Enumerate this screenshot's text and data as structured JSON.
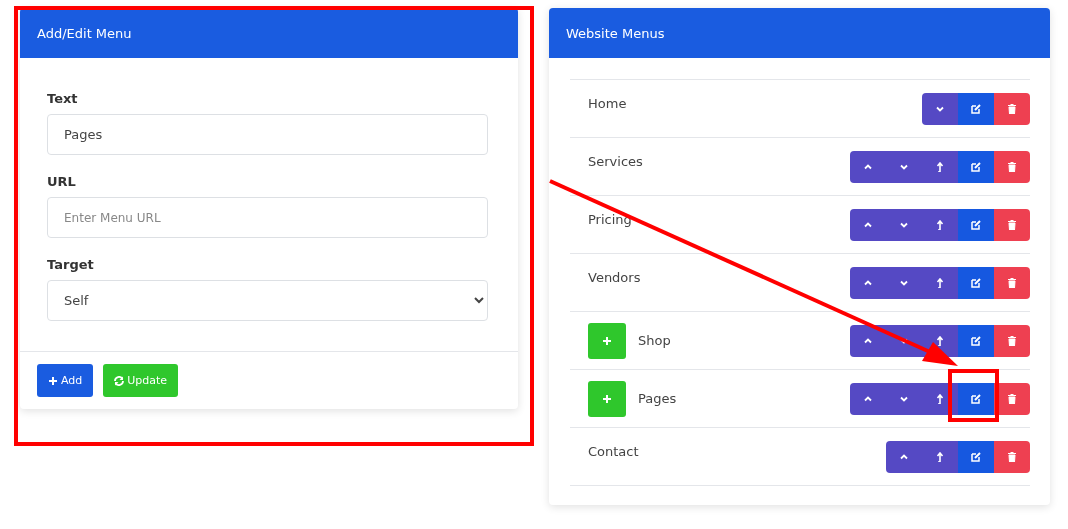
{
  "form_panel": {
    "title": "Add/Edit Menu",
    "fields": [
      {
        "kind": "text",
        "label": "Text",
        "value": "Pages"
      },
      {
        "kind": "text",
        "label": "URL",
        "placeholder": "Enter Menu URL"
      },
      {
        "kind": "select",
        "label": "Target",
        "value": "Self"
      }
    ],
    "buttons": [
      {
        "kind": "add",
        "label": "Add"
      },
      {
        "kind": "update",
        "label": "Update"
      }
    ]
  },
  "menus_panel": {
    "title": "Website Menus",
    "items": [
      {
        "name": "Home",
        "indent_button": false,
        "actions": [
          {
            "kind": "down"
          },
          {
            "kind": "edit"
          },
          {
            "kind": "delete"
          }
        ]
      },
      {
        "name": "Services",
        "indent_button": false,
        "actions": [
          {
            "kind": "up"
          },
          {
            "kind": "down"
          },
          {
            "kind": "outdent"
          },
          {
            "kind": "edit"
          },
          {
            "kind": "delete"
          }
        ]
      },
      {
        "name": "Pricing",
        "indent_button": false,
        "actions": [
          {
            "kind": "up"
          },
          {
            "kind": "down"
          },
          {
            "kind": "outdent"
          },
          {
            "kind": "edit"
          },
          {
            "kind": "delete"
          }
        ]
      },
      {
        "name": "Vendors",
        "indent_button": false,
        "actions": [
          {
            "kind": "up"
          },
          {
            "kind": "down"
          },
          {
            "kind": "outdent"
          },
          {
            "kind": "edit"
          },
          {
            "kind": "delete"
          }
        ]
      },
      {
        "name": "Shop",
        "indent_button": true,
        "actions": [
          {
            "kind": "up"
          },
          {
            "kind": "down"
          },
          {
            "kind": "outdent"
          },
          {
            "kind": "edit"
          },
          {
            "kind": "delete"
          }
        ]
      },
      {
        "name": "Pages",
        "indent_button": true,
        "actions": [
          {
            "kind": "up"
          },
          {
            "kind": "down"
          },
          {
            "kind": "outdent"
          },
          {
            "kind": "edit"
          },
          {
            "kind": "delete"
          }
        ]
      },
      {
        "name": "Contact",
        "indent_button": false,
        "actions": [
          {
            "kind": "up"
          },
          {
            "kind": "outdent"
          },
          {
            "kind": "edit"
          },
          {
            "kind": "delete"
          }
        ]
      }
    ]
  },
  "annotations": [
    {
      "kind": "box"
    },
    {
      "kind": "arrow"
    },
    {
      "kind": "box"
    }
  ]
}
